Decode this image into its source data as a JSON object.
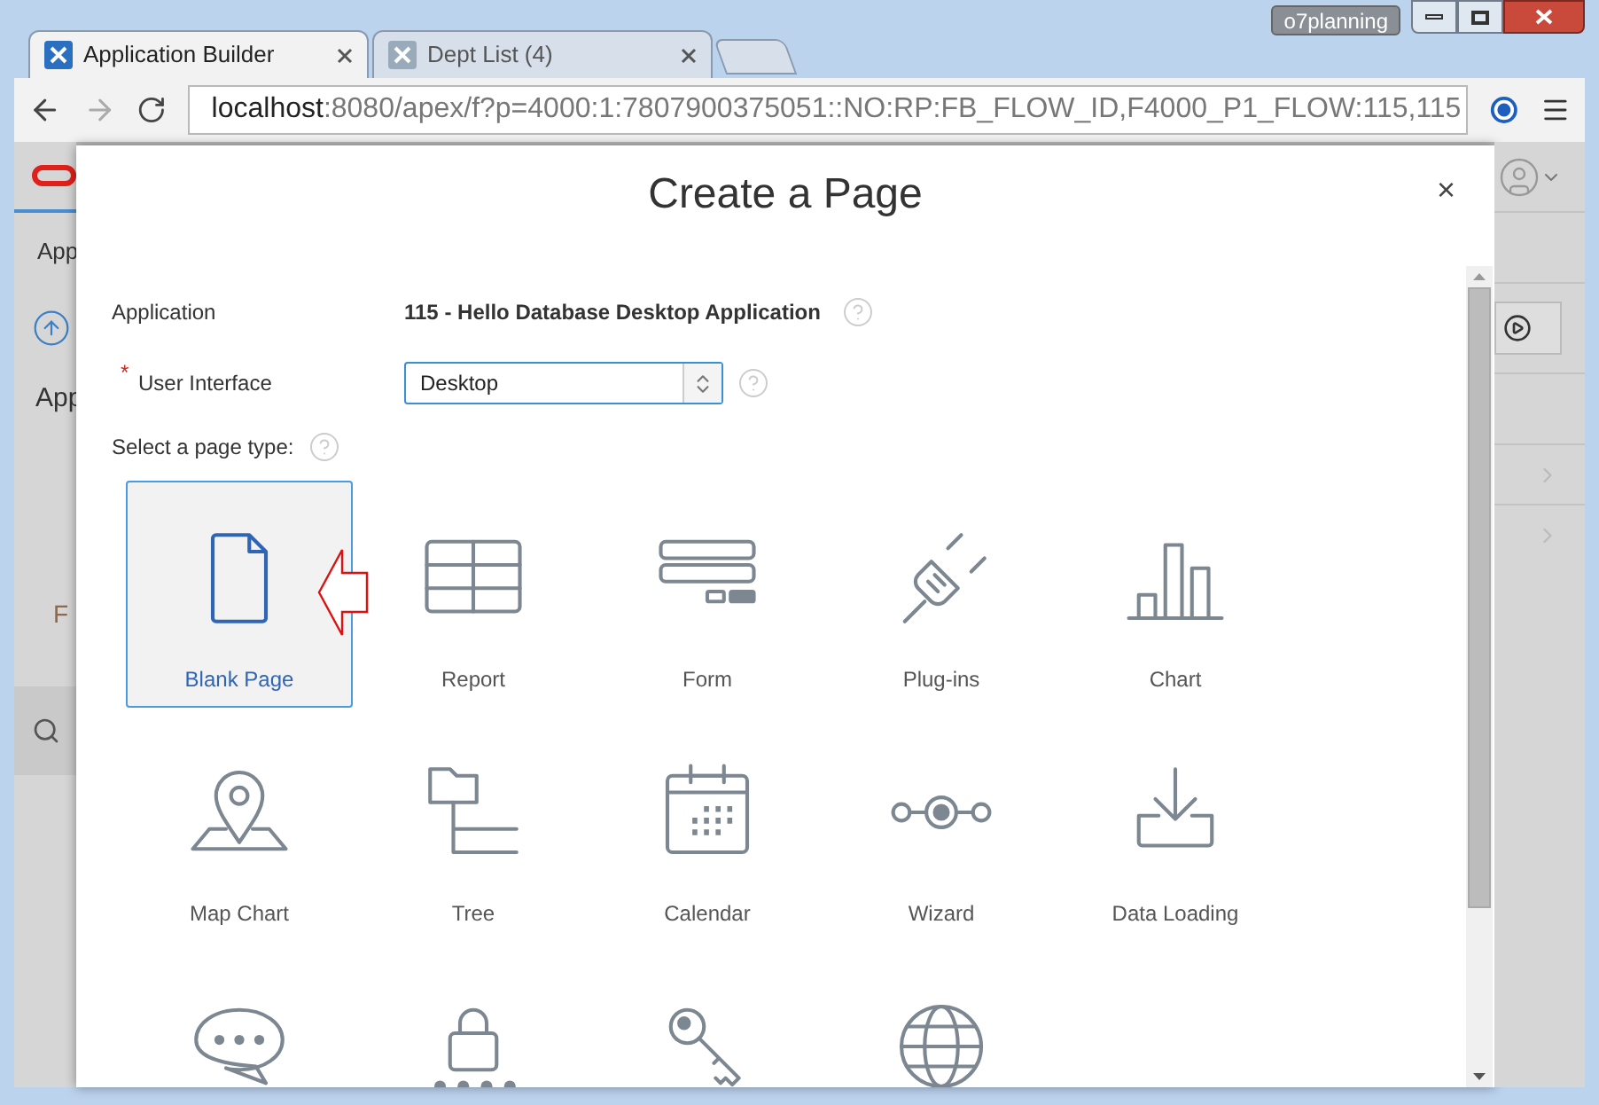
{
  "browser": {
    "tabs": [
      {
        "title": "Application Builder",
        "selected": true
      },
      {
        "title": "Dept List (4)",
        "selected": false
      }
    ],
    "profile": "o7planning",
    "url_host": "localhost",
    "url_rest": ":8080/apex/f?p=4000:1:7807900375051::NO:RP:FB_FLOW_ID,F4000_P1_FLOW:115,115"
  },
  "background": {
    "tab_label": "App",
    "region_title": "App",
    "region_text": "F"
  },
  "dialog": {
    "title": "Create a Page",
    "close": "×",
    "fields": [
      {
        "kind": "text",
        "label": "Application",
        "value": "115 - Hello Database Desktop Application"
      },
      {
        "kind": "select",
        "label": "User Interface",
        "value": "Desktop",
        "marker": "*"
      }
    ],
    "page_type_label": "Select a page type:",
    "page_types": [
      {
        "kind": "blank",
        "label": "Blank Page",
        "selected": true
      },
      {
        "kind": "report",
        "label": "Report",
        "selected": false
      },
      {
        "kind": "form",
        "label": "Form",
        "selected": false
      },
      {
        "kind": "plugin",
        "label": "Plug-ins",
        "selected": false
      },
      {
        "kind": "chart",
        "label": "Chart",
        "selected": false
      },
      {
        "kind": "map",
        "label": "Map Chart",
        "selected": false
      },
      {
        "kind": "tree",
        "label": "Tree",
        "selected": false
      },
      {
        "kind": "calendar",
        "label": "Calendar",
        "selected": false
      },
      {
        "kind": "wizard",
        "label": "Wizard",
        "selected": false
      },
      {
        "kind": "dataload",
        "label": "Data Loading",
        "selected": false
      },
      {
        "kind": "feedback",
        "selected": false
      },
      {
        "kind": "login",
        "selected": false
      },
      {
        "kind": "access",
        "selected": false
      },
      {
        "kind": "global",
        "selected": false
      }
    ]
  }
}
